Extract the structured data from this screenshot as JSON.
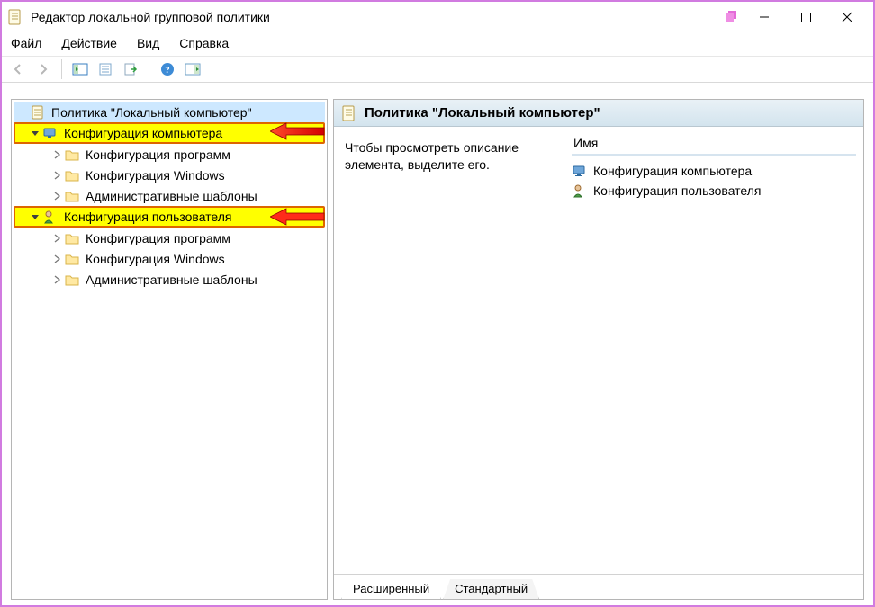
{
  "window": {
    "title": "Редактор локальной групповой политики"
  },
  "menu": {
    "items": [
      "Файл",
      "Действие",
      "Вид",
      "Справка"
    ]
  },
  "toolbar": {
    "buttons": [
      {
        "name": "back-icon"
      },
      {
        "name": "forward-icon"
      },
      {
        "name": "divider"
      },
      {
        "name": "show-hide-tree-icon"
      },
      {
        "name": "properties-icon"
      },
      {
        "name": "export-list-icon"
      },
      {
        "name": "divider"
      },
      {
        "name": "help-icon"
      },
      {
        "name": "filter-icon"
      }
    ]
  },
  "tree": {
    "root": {
      "label": "Политика \"Локальный компьютер\"",
      "icon": "gpedit-doc-icon",
      "highlight": "blue"
    },
    "nodes": [
      {
        "label": "Конфигурация компьютера",
        "icon": "computer-config-icon",
        "highlight": "yellow",
        "children": [
          {
            "label": "Конфигурация программ"
          },
          {
            "label": "Конфигурация Windows"
          },
          {
            "label": "Административные шаблоны"
          }
        ]
      },
      {
        "label": "Конфигурация пользователя",
        "icon": "user-config-icon",
        "highlight": "yellow",
        "children": [
          {
            "label": "Конфигурация программ"
          },
          {
            "label": "Конфигурация Windows"
          },
          {
            "label": "Административные шаблоны"
          }
        ]
      }
    ]
  },
  "right": {
    "header": "Политика \"Локальный компьютер\"",
    "description": "Чтобы просмотреть описание элемента, выделите его.",
    "column_header": "Имя",
    "items": [
      {
        "label": "Конфигурация компьютера",
        "icon": "computer-config-icon"
      },
      {
        "label": "Конфигурация пользователя",
        "icon": "user-config-icon"
      }
    ]
  },
  "tabs": {
    "items": [
      "Расширенный",
      "Стандартный"
    ],
    "active": 0
  }
}
